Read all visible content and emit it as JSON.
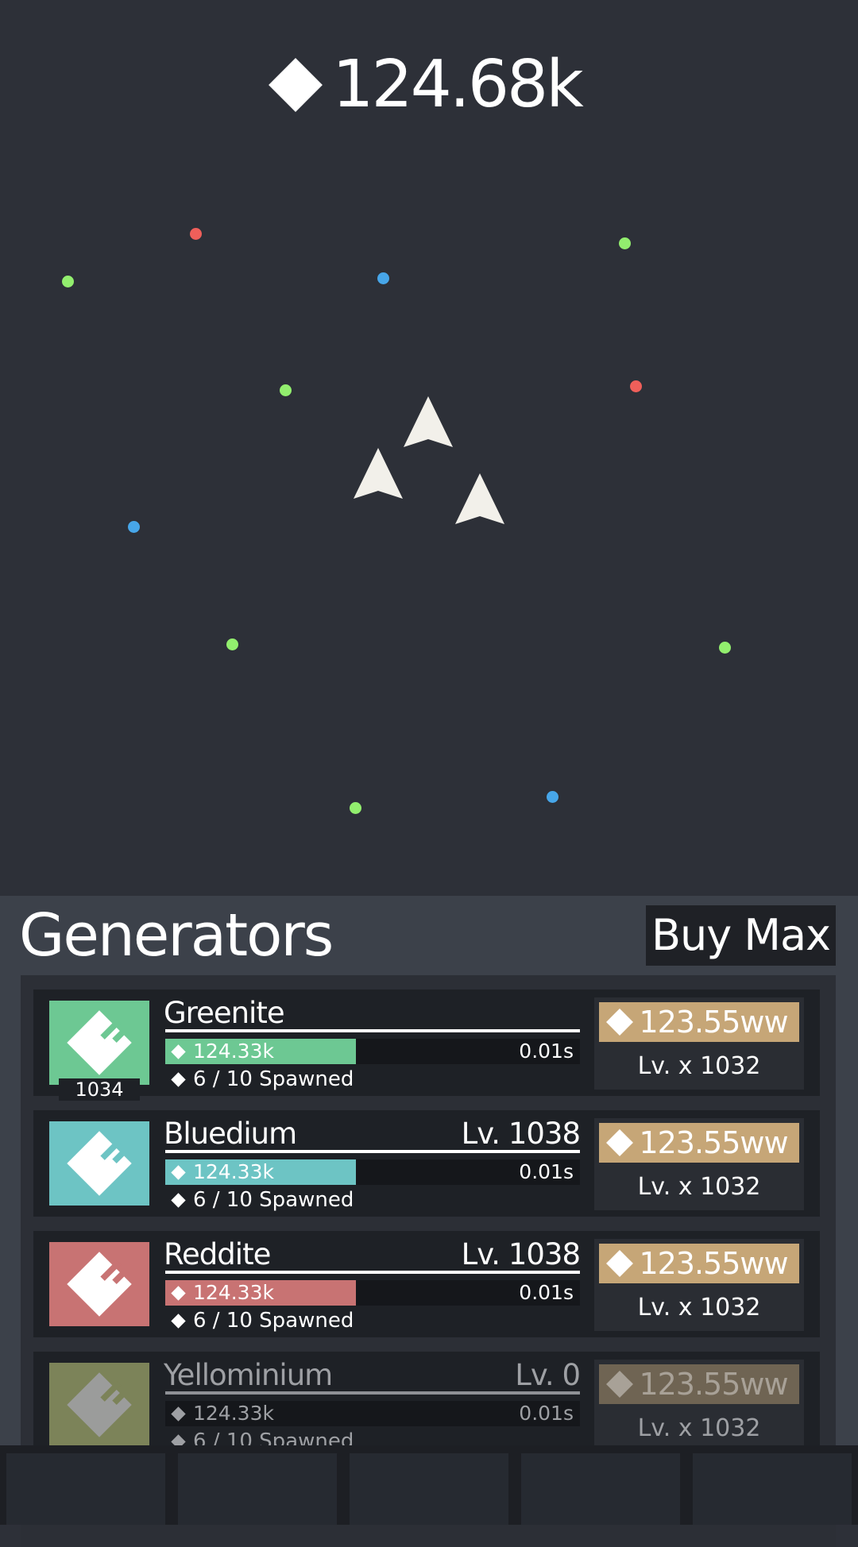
{
  "currency": {
    "icon": "diamond-icon",
    "amount": "124.68k"
  },
  "playfield": {
    "dot_colors": {
      "green": "#92ee6e",
      "red": "#ef5f5a",
      "blue": "#47a6e9"
    },
    "ship_color": "#f2f0ea"
  },
  "panel": {
    "title": "Generators",
    "buy_max_label": "Buy Max"
  },
  "generators": [
    {
      "name": "Greenite",
      "level": "",
      "count": "1034",
      "color": "#6dc893",
      "bar_value": "124.33k",
      "bar_fill_fraction": 0.46,
      "time": "0.01s",
      "spawned": "6 / 10 Spawned",
      "cost": "123.55ww",
      "multiplier": "Lv. x 1032",
      "locked": false
    },
    {
      "name": "Bluedium",
      "level": "Lv. 1038",
      "count": "",
      "color": "#6dc4c4",
      "bar_value": "124.33k",
      "bar_fill_fraction": 0.46,
      "time": "0.01s",
      "spawned": "6 / 10 Spawned",
      "cost": "123.55ww",
      "multiplier": "Lv. x 1032",
      "locked": false
    },
    {
      "name": "Reddite",
      "level": "Lv. 1038",
      "count": "",
      "color": "#c87373",
      "bar_value": "124.33k",
      "bar_fill_fraction": 0.46,
      "time": "0.01s",
      "spawned": "6 / 10 Spawned",
      "cost": "123.55ww",
      "multiplier": "Lv. x 1032",
      "locked": false
    },
    {
      "name": "Yellominium",
      "level": "Lv. 0",
      "count": "",
      "color": "#7c8359",
      "bar_value": "124.33k",
      "bar_fill_fraction": 0,
      "time": "0.01s",
      "spawned": "6 / 10 Spawned",
      "cost": "123.55ww",
      "multiplier": "Lv. x 1032",
      "locked": true
    }
  ]
}
